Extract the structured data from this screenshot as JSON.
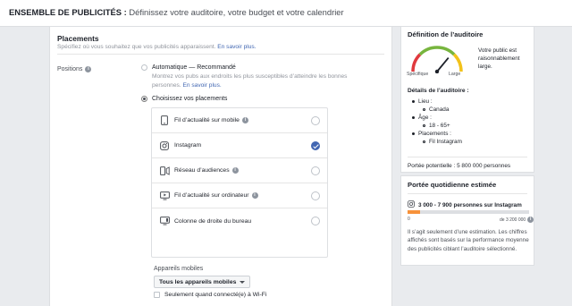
{
  "header": {
    "title_strong": "ENSEMBLE DE PUBLICITÉS :",
    "title_rest": " Définissez votre auditoire, votre budget et votre calendrier"
  },
  "placements": {
    "title": "Placements",
    "subtitle": "Spécifiez où vous souhaitez que vos publicités apparaissent.",
    "learn_more": "En savoir plus.",
    "positions_label": "Positions",
    "auto_label": "Automatique — Recommandé",
    "auto_desc": "Montrez vos pubs aux endroits les plus susceptibles d’atteindre les bonnes personnes.",
    "auto_learn_more": "En savoir plus.",
    "choose_label": "Choisissez vos placements",
    "selected_option": "choose",
    "items": [
      {
        "label": "Fil d’actualité sur mobile",
        "icon": "mobile-icon",
        "info": true,
        "checked": false
      },
      {
        "label": "Instagram",
        "icon": "instagram-icon",
        "info": false,
        "checked": true
      },
      {
        "label": "Réseau d’audiences",
        "icon": "audience-network-icon",
        "info": true,
        "checked": false
      },
      {
        "label": "Fil d’actualité sur ordinateur",
        "icon": "desktop-icon",
        "info": true,
        "checked": false
      },
      {
        "label": "Colonne de droite du bureau",
        "icon": "right-column-icon",
        "info": false,
        "checked": false
      }
    ],
    "mobile_devices_label": "Appareils mobiles",
    "devices_select": "Tous les appareils mobiles",
    "wifi_label": "Seulement quand connecté(e) à Wi-Fi",
    "wifi_checked": false
  },
  "audience": {
    "title": "Définition de l’auditoire",
    "gauge_text": "Votre public est raisonnablement large.",
    "gauge_left": "Spécifique",
    "gauge_right": "Large",
    "gauge_level": 0.72,
    "details_title": "Détails de l’auditoire :",
    "location_label": "Lieu :",
    "location_value": "Canada",
    "age_label": "Âge :",
    "age_value": "18 - 65+",
    "placements_label": "Placements :",
    "placements_value": "Fil Instagram",
    "potential_reach": "Portée potentielle : 5 800 000 personnes"
  },
  "daily": {
    "title": "Portée quotidienne estimée",
    "range": "3 000 - 7 900 personnes sur Instagram",
    "bar_min": "0",
    "bar_max": "de 3 200 000",
    "bar_fill_fraction": 0.1,
    "disclaimer": "Il s’agit seulement d’une estimation. Les chiffres affichés sont basés sur la performance moyenne des publicités ciblant l’auditoire sélectionné."
  },
  "colors": {
    "accent": "#4267b2",
    "reach_bar": "#f7923a",
    "page_bg": "#e9ebee"
  }
}
